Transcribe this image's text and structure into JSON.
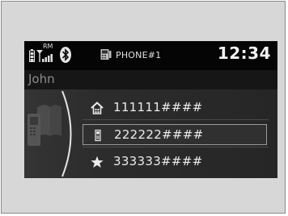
{
  "status_bar": {
    "signal_label": "RM",
    "phone_name": "PHONE#1",
    "time": "12:34"
  },
  "contact": {
    "name": "John"
  },
  "numbers": [
    {
      "icon": "home-icon",
      "value": "111111####"
    },
    {
      "icon": "mobile-phone-icon",
      "value": "222222####"
    },
    {
      "icon": "star-icon",
      "value": "333333####"
    }
  ],
  "selected_index": 1,
  "colors": {
    "screen_bg": "#202020",
    "status_bg": "#050505",
    "selection_border": "#9a9a9a",
    "text": "#ececec",
    "dim_text": "#8c8c8c"
  }
}
